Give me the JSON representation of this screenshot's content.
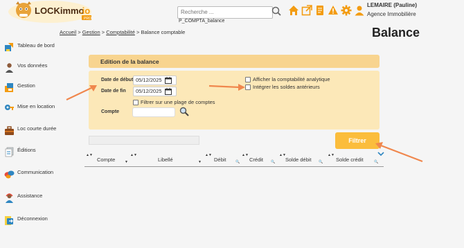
{
  "logo": {
    "text": "LOCKimmo",
    "suffix": ".io",
    "badge": "PRO"
  },
  "search": {
    "placeholder": "Recherche ..."
  },
  "page_code": "P_COMPTA_balance",
  "user": {
    "name": "LEMAIRE (Pauline)",
    "org": "Agence Immobilière"
  },
  "header_icons": [
    "home-icon",
    "external-link-icon",
    "document-icon",
    "alert-icon",
    "settings-icon",
    "user-icon"
  ],
  "breadcrumb": {
    "items": [
      "Accueil",
      "Gestion",
      "Comptabilité"
    ],
    "separator": ">",
    "current": "Balance comptable"
  },
  "title": "Balance",
  "sidebar": {
    "items": [
      {
        "label": "Tableau de bord",
        "icon": "dashboard-icon"
      },
      {
        "label": "Vos données",
        "icon": "person-icon"
      },
      {
        "label": "Gestion",
        "icon": "folder-icon"
      },
      {
        "label": "Mise en location",
        "icon": "key-icon"
      },
      {
        "label": "Loc courte durée",
        "icon": "suitcase-icon"
      },
      {
        "label": "Éditions",
        "icon": "documents-icon"
      },
      {
        "label": "Communication",
        "icon": "chat-bubbles-icon"
      },
      {
        "label": "Assistance",
        "icon": "support-icon"
      },
      {
        "label": "Déconnexion",
        "icon": "logout-icon"
      }
    ]
  },
  "panel": {
    "title": "Edition de la balance",
    "date_debut": {
      "label": "Date de début",
      "value": "05/12/2025"
    },
    "date_fin": {
      "label": "Date de fin",
      "value": "05/12/2025"
    },
    "compte": {
      "label": "Compte",
      "value": ""
    },
    "options": {
      "plage": "Filtrer sur une plage de comptes",
      "analytique": "Afficher la comptabilité analytique",
      "soldes": "Intégrer les soldes antérieurs"
    }
  },
  "filter_button": "Filtrer",
  "table": {
    "columns": [
      "Compte",
      "Libellé",
      "Débit",
      "Crédit",
      "Solde débit",
      "Solde crédit"
    ]
  },
  "colors": {
    "accent": "#f39c12",
    "panel_header": "#f8d48f",
    "panel_body": "#fce8b8",
    "button": "#fbbd3c",
    "arrow": "#f0874d"
  }
}
